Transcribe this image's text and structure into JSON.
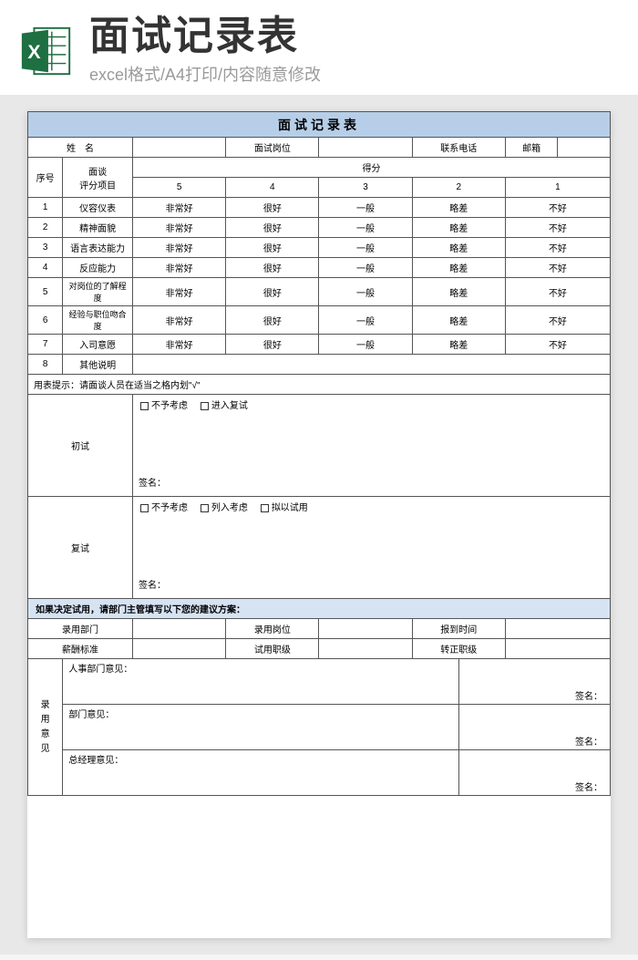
{
  "header": {
    "main_title": "面试记录表",
    "subtitle": "excel格式/A4打印/内容随意修改"
  },
  "form": {
    "title": "面试记录表",
    "info_labels": {
      "name": "姓　名",
      "position": "面试岗位",
      "phone": "联系电话",
      "email": "邮箱"
    },
    "score_header": {
      "seq": "序号",
      "item": "面谈\n评分项目",
      "score": "得分",
      "cols": [
        "5",
        "4",
        "3",
        "2",
        "1"
      ]
    },
    "score_rows": [
      {
        "n": "1",
        "item": "仪容仪表",
        "v": [
          "非常好",
          "很好",
          "一般",
          "略差",
          "不好"
        ]
      },
      {
        "n": "2",
        "item": "精神面貌",
        "v": [
          "非常好",
          "很好",
          "一般",
          "略差",
          "不好"
        ]
      },
      {
        "n": "3",
        "item": "语言表达能力",
        "v": [
          "非常好",
          "很好",
          "一般",
          "略差",
          "不好"
        ]
      },
      {
        "n": "4",
        "item": "反应能力",
        "v": [
          "非常好",
          "很好",
          "一般",
          "略差",
          "不好"
        ]
      },
      {
        "n": "5",
        "item": "对岗位的了解程度",
        "v": [
          "非常好",
          "很好",
          "一般",
          "略差",
          "不好"
        ]
      },
      {
        "n": "6",
        "item": "经验与职位吻合度",
        "v": [
          "非常好",
          "很好",
          "一般",
          "略差",
          "不好"
        ]
      },
      {
        "n": "7",
        "item": "入司意愿",
        "v": [
          "非常好",
          "很好",
          "一般",
          "略差",
          "不好"
        ]
      },
      {
        "n": "8",
        "item": "其他说明",
        "v": [
          "",
          "",
          "",
          "",
          ""
        ]
      }
    ],
    "hint": "用表提示：请面谈人员在适当之格内划\"√\"",
    "initial": {
      "label": "初试",
      "opt1": "不予考虑",
      "opt2": "进入复试",
      "sign": "签名："
    },
    "retest": {
      "label": "复试",
      "opt1": "不予考虑",
      "opt2": "列入考虑",
      "opt3": "拟以试用",
      "sign": "签名："
    },
    "decision_band": "如果决定试用，请部门主管填写以下您的建议方案：",
    "hire": {
      "dept": "录用部门",
      "post": "录用岗位",
      "report": "报到时间",
      "salary": "薪酬标准",
      "trial_rank": "试用职级",
      "regular_rank": "转正职级"
    },
    "opinions": {
      "header": "录\n用\n意\n见",
      "hr": "人事部门意见：",
      "dept": "部门意见：",
      "gm": "总经理意见：",
      "sign": "签名："
    }
  }
}
